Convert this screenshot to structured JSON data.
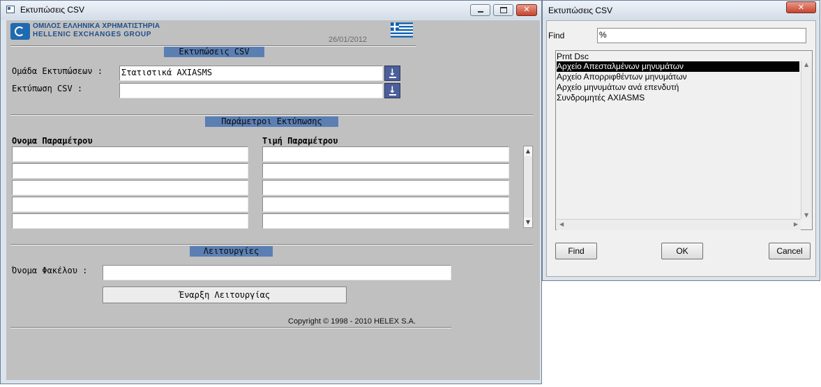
{
  "main_window": {
    "title": "Εκτυπώσεις CSV",
    "controls": {
      "minimize": "▭",
      "maximize": "▢",
      "close": "✕"
    }
  },
  "header": {
    "logo_line1": "ΟΜΙΛΟΣ ΕΛΛΗΝΙΚΑ ΧΡΗΜΑΤΙΣΤΗΡΙΑ",
    "logo_line2": "HELLENIC EXCHANGES GROUP",
    "date": "26/01/2012"
  },
  "section_print": {
    "title": "Εκτυπώσεις CSV",
    "group_label": "Ομάδα Εκτυπώσεων :",
    "group_value": "Στατιστικά AXIASMS",
    "print_label": "Εκτύπωση CSV :",
    "print_value": ""
  },
  "section_params": {
    "title": "Παράμετροι Εκτύπωσης",
    "col_name": "Ονομα Παραμέτρου",
    "col_value": "Τιμή Παραμέτρου",
    "rows": [
      {
        "name": "",
        "value": ""
      },
      {
        "name": "",
        "value": ""
      },
      {
        "name": "",
        "value": ""
      },
      {
        "name": "",
        "value": ""
      },
      {
        "name": "",
        "value": ""
      }
    ]
  },
  "section_ops": {
    "title": "Λειτουργίες",
    "folder_label": "Όνομα Φακέλου :",
    "folder_value": "",
    "start_button": "Έναρξη Λειτουργίας"
  },
  "footer": {
    "copyright": "Copyright © 1998 - 2010 HELEX S.A."
  },
  "dialog": {
    "title": "Εκτυπώσεις CSV",
    "close": "✕",
    "find_label": "Find",
    "find_value": "%",
    "list_header": "Prnt Dsc",
    "items": [
      "Αρχείο Απεσταλμένων μηνυμάτων",
      "Αρχείο Απορριφθέντων μηνυμάτων",
      "Αρχείο μηνυμάτων ανά επενδυτή",
      "Συνδρομητές AXIASMS"
    ],
    "selected_index": 0,
    "buttons": {
      "find": "Find",
      "ok": "OK",
      "cancel": "Cancel"
    }
  },
  "colors": {
    "section_bar": "#5b7fb3",
    "client_bg": "#c0c0c0",
    "lov_button": "#4b5f9a",
    "selection": "#000000"
  }
}
